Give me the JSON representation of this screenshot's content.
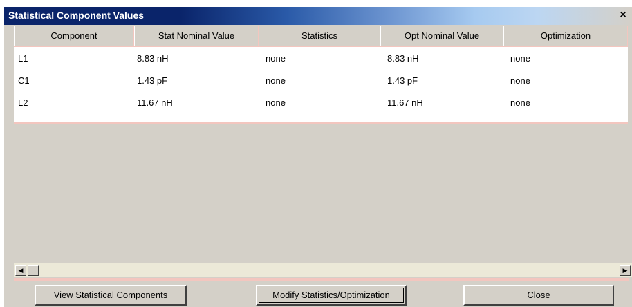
{
  "window": {
    "title": "Statistical Component Values",
    "close_label": "×"
  },
  "table": {
    "columns": [
      "Component",
      "Stat Nominal Value",
      "Statistics",
      "Opt Nominal Value",
      "Optimization"
    ],
    "rows": [
      [
        "L1",
        "8.83 nH",
        "none",
        "8.83 nH",
        "none"
      ],
      [
        "C1",
        "1.43 pF",
        "none",
        "1.43 pF",
        "none"
      ],
      [
        "L2",
        "11.67 nH",
        "none",
        "11.67 nH",
        "none"
      ]
    ]
  },
  "scrollbar": {
    "left_arrow": "◀",
    "right_arrow": "▶"
  },
  "buttons": {
    "view": "View Statistical Components",
    "modify": "Modify Statistics/Optimization",
    "close": "Close"
  }
}
